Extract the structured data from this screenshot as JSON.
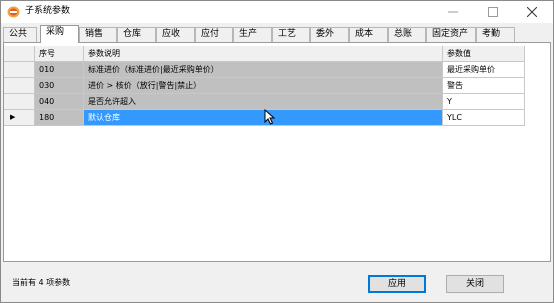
{
  "window": {
    "title": "子系统参数"
  },
  "tabs": [
    {
      "label": "公共"
    },
    {
      "label": "采购"
    },
    {
      "label": "销售"
    },
    {
      "label": "仓库"
    },
    {
      "label": "应收"
    },
    {
      "label": "应付"
    },
    {
      "label": "生产"
    },
    {
      "label": "工艺"
    },
    {
      "label": "委外"
    },
    {
      "label": "成本"
    },
    {
      "label": "总账"
    },
    {
      "label": "固定资产"
    },
    {
      "label": "考勤"
    }
  ],
  "active_tab": "采购",
  "grid": {
    "headers": {
      "code": "序号",
      "description": "参数说明",
      "value": "参数值"
    },
    "rows": [
      {
        "code": "010",
        "description": "标准进价（标准进价|最近采购单价）",
        "value": "最近采购单价"
      },
      {
        "code": "030",
        "description": "进价 > 核价（放行|警告|禁止）",
        "value": "警告"
      },
      {
        "code": "040",
        "description": "是否允许超入",
        "value": "Y"
      },
      {
        "code": "180",
        "description": "默认仓库",
        "value": "YLC",
        "current": true,
        "indicator": "▶"
      }
    ]
  },
  "status": {
    "text": "当前有 4 项参数"
  },
  "buttons": {
    "apply": "应用",
    "close": "关闭"
  },
  "colors": {
    "selection": "#3399ff",
    "readonly_cell": "#c0c0c0",
    "tab_active": "#ffffff"
  }
}
